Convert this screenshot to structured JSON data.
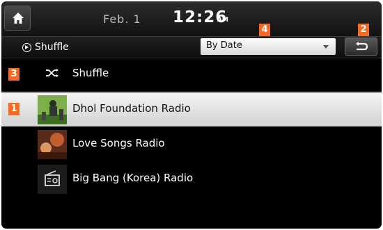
{
  "status": {
    "date": "Feb. 1",
    "time": "12:26",
    "ampm": "AM"
  },
  "header": {
    "mode_label": "Shuffle",
    "sort_value": "By Date"
  },
  "list": {
    "shuffle_label": "Shuffle",
    "stations": [
      {
        "label": "Dhol Foundation Radio",
        "selected": true
      },
      {
        "label": "Love Songs Radio",
        "selected": false
      },
      {
        "label": "Big Bang (Korea) Radio",
        "selected": false
      }
    ]
  },
  "badges": {
    "b1": "1",
    "b2": "2",
    "b3": "3",
    "b4": "4"
  },
  "colors": {
    "badge": "#f36b21",
    "selected_row": "#e6e6e6",
    "background": "#000000"
  },
  "icons": [
    "home-icon",
    "play-circle-icon",
    "back-arrow-icon",
    "shuffle-icon",
    "radio-icon",
    "dropdown-arrow-icon"
  ]
}
